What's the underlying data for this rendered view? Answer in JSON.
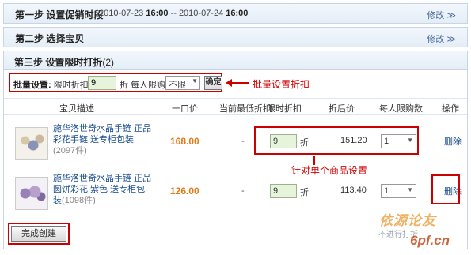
{
  "step1": {
    "title": "第一步 设置促销时段",
    "date_from": "2010-07-23",
    "time_from": "16:00",
    "separator": "--",
    "date_to": "2010-07-24",
    "time_to": "16:00",
    "modify": "修改 ≫"
  },
  "step2": {
    "title": "第二步 选择宝贝",
    "modify": "修改 ≫"
  },
  "step3": {
    "title": "第三步 设置限时打折",
    "count": "(2)"
  },
  "batch": {
    "label": "批量设置:",
    "discount_label": "限时折扣",
    "discount_value": "9",
    "zhe": "折",
    "limit_label": "每人限购数",
    "limit_value": "不限",
    "confirm": "确定"
  },
  "annotations": {
    "batch_note": "批量设置折扣",
    "single_note": "针对单个商品设置"
  },
  "table": {
    "headers": [
      "宝贝描述",
      "一口价",
      "当前最低折扣",
      "限时折扣",
      "折后价",
      "每人限购数",
      "操作"
    ],
    "rows": [
      {
        "name": "施华洛世奇水晶手链 正品 彩花手链 送专柜包装",
        "sold": "(2097件)",
        "price": "168.00",
        "lowest": "-",
        "discount": "9",
        "zhe": "折",
        "after_price": "151.20",
        "limit": "1",
        "action": "删除"
      },
      {
        "name": "施华洛世奇水晶手链 正品 圆饼彩花 紫色 送专柜包装",
        "sold": "(1098件)",
        "price": "126.00",
        "lowest": "-",
        "discount": "9",
        "zhe": "折",
        "after_price": "113.40",
        "limit": "1",
        "action": "删除"
      }
    ]
  },
  "footer": {
    "create_button": "完成创建"
  },
  "watermark": {
    "line1": "依源论友",
    "line2": "不进行打折",
    "line3": "6pf.cn"
  },
  "colors": {
    "annotation_red": "#cc0000",
    "price_orange": "#e67817",
    "link_blue": "#1a4d8f"
  }
}
